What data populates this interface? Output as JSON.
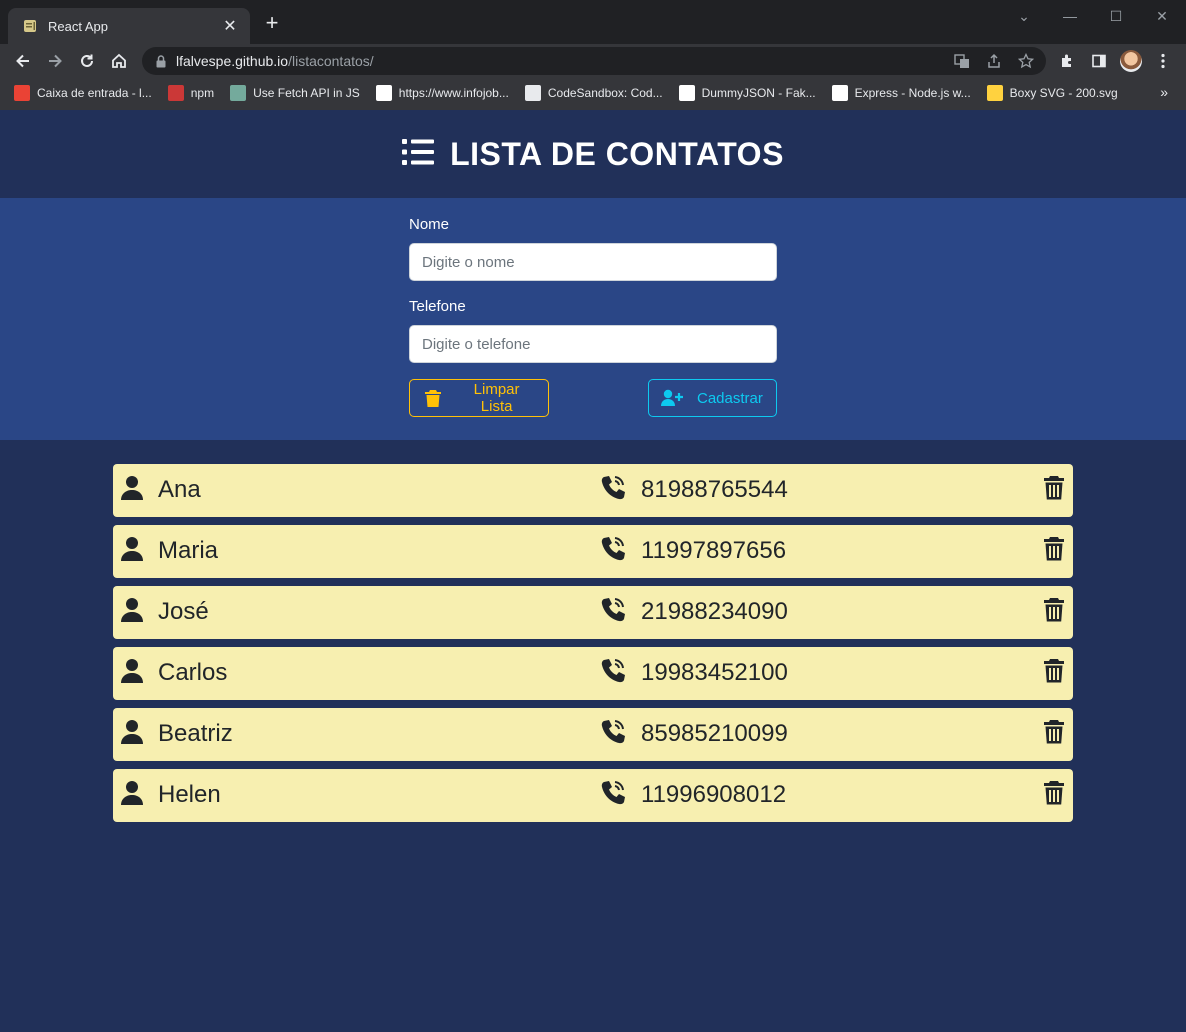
{
  "browser": {
    "tab_title": "React App",
    "url_host": "lfalvespe.github.io",
    "url_path": "/listacontatos/",
    "bookmarks": [
      {
        "label": "Caixa de entrada - l...",
        "icon": "gmail-icon",
        "color": "#ea4335"
      },
      {
        "label": "npm",
        "icon": "npm-icon",
        "color": "#cb3837"
      },
      {
        "label": "Use Fetch API in JS",
        "icon": "chatgpt-icon",
        "color": "#74aa9c"
      },
      {
        "label": "https://www.infojob...",
        "icon": "infojobs-icon",
        "color": "#ffffff"
      },
      {
        "label": "CodeSandbox: Cod...",
        "icon": "codesandbox-icon",
        "color": "#e8eaed"
      },
      {
        "label": "DummyJSON - Fak...",
        "icon": "dummyjson-icon",
        "color": "#ffffff"
      },
      {
        "label": "Express - Node.js w...",
        "icon": "express-icon",
        "color": "#ffffff"
      },
      {
        "label": "Boxy SVG - 200.svg",
        "icon": "boxy-svg-icon",
        "color": "#ffd23f"
      }
    ]
  },
  "app": {
    "title": "LISTA DE CONTATOS",
    "form": {
      "name_label": "Nome",
      "name_placeholder": "Digite o nome",
      "name_value": "",
      "phone_label": "Telefone",
      "phone_placeholder": "Digite o telefone",
      "phone_value": "",
      "clear_label": "Limpar Lista",
      "add_label": "Cadastrar"
    },
    "contacts": [
      {
        "name": "Ana",
        "phone": "81988765544"
      },
      {
        "name": "Maria",
        "phone": "11997897656"
      },
      {
        "name": "José",
        "phone": "21988234090"
      },
      {
        "name": "Carlos",
        "phone": "19983452100"
      },
      {
        "name": "Beatriz",
        "phone": "85985210099"
      },
      {
        "name": "Helen",
        "phone": "11996908012"
      }
    ],
    "colors": {
      "header_bg": "#213059",
      "form_bg": "#2a4686",
      "row_bg": "#f7efb0",
      "warning": "#ffc107",
      "info": "#0dcaf0"
    }
  }
}
